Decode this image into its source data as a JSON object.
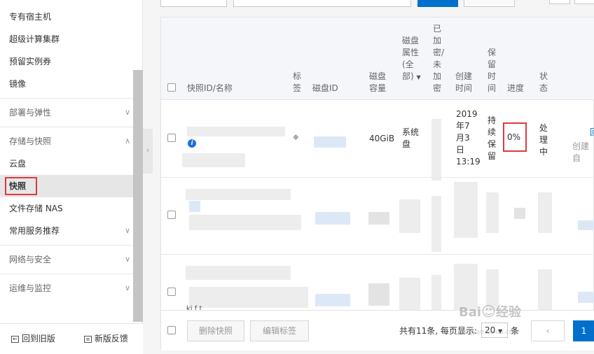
{
  "sidebar": {
    "items": [
      {
        "label": "专有宿主机"
      },
      {
        "label": "超级计算集群"
      },
      {
        "label": "预留实例券"
      },
      {
        "label": "镜像"
      }
    ],
    "groups": [
      {
        "label": "部署与弹性",
        "expanded": false
      },
      {
        "label": "存储与快照",
        "expanded": true
      },
      {
        "label": "常用服务推荐",
        "expanded": false
      },
      {
        "label": "网络与安全",
        "expanded": false
      },
      {
        "label": "运维与监控",
        "expanded": false
      }
    ],
    "storage_items": [
      {
        "label": "云盘"
      },
      {
        "label": "快照",
        "active": true
      },
      {
        "label": "文件存储 NAS"
      }
    ],
    "footer": {
      "back_label": "回到旧版",
      "feedback_label": "新版反馈"
    }
  },
  "table": {
    "headers": {
      "name": "快照ID/名称",
      "tag": "标签",
      "disk_id": "磁盘ID",
      "capacity": "磁盘容量",
      "attr": "磁盘属性(全部)",
      "encrypted": "已加密/未加密",
      "created": "创建时间",
      "retention": "保留时间",
      "progress": "进度",
      "status": "状态"
    },
    "rows": [
      {
        "capacity": "40GiB",
        "attr": "系统盘",
        "created": "2019年7月3日13:19",
        "retention": "持续保留",
        "progress": "0%",
        "status": "处理中",
        "action": "回",
        "action2": "创建自"
      }
    ],
    "row3_fragment": "ki f t",
    "footer": {
      "delete_label": "删除快照",
      "edit_tag_label": "编辑标签",
      "total_text": "共有11条, 每页显示:",
      "page_size": "20",
      "unit": "条",
      "current_page": "1"
    }
  },
  "colors": {
    "primary": "#0070cc",
    "highlight": "#e0393e"
  }
}
